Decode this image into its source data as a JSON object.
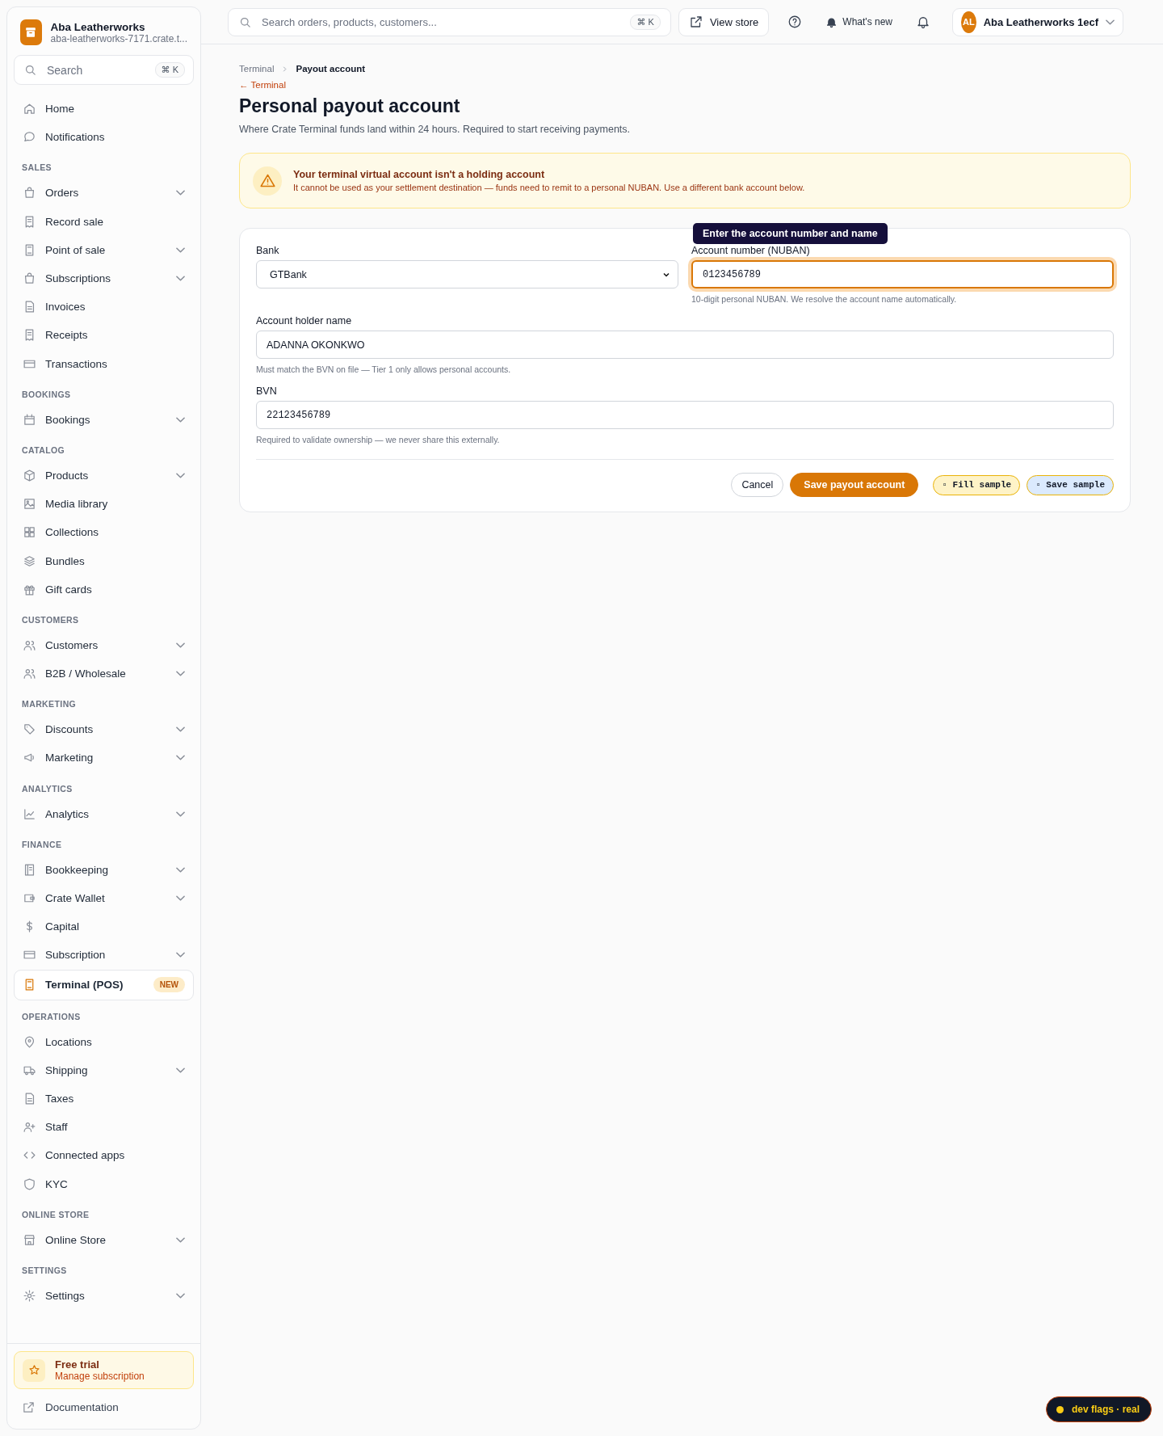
{
  "sidebar": {
    "store_name": "Aba Leatherworks",
    "store_url": "aba-leatherworks-7171.crate.t...",
    "search": {
      "placeholder": "Search",
      "shortcut": "⌘ K"
    },
    "groups": [
      {
        "items": [
          {
            "label": "Home",
            "expandable": false,
            "selected": false
          },
          {
            "label": "Notifications",
            "expandable": false,
            "selected": false
          }
        ]
      },
      {
        "title": "SALES",
        "items": [
          {
            "label": "Orders",
            "expandable": true,
            "selected": false
          },
          {
            "label": "Record sale",
            "expandable": false,
            "selected": false
          },
          {
            "label": "Point of sale",
            "expandable": true,
            "selected": false
          },
          {
            "label": "Subscriptions",
            "expandable": true,
            "selected": false
          },
          {
            "label": "Invoices",
            "expandable": false,
            "selected": false
          },
          {
            "label": "Receipts",
            "expandable": false,
            "selected": false
          },
          {
            "label": "Transactions",
            "expandable": false,
            "selected": false
          }
        ]
      },
      {
        "title": "BOOKINGS",
        "items": [
          {
            "label": "Bookings",
            "expandable": true,
            "selected": false
          }
        ]
      },
      {
        "title": "CATALOG",
        "items": [
          {
            "label": "Products",
            "expandable": true,
            "selected": false
          },
          {
            "label": "Media library",
            "expandable": false,
            "selected": false
          },
          {
            "label": "Collections",
            "expandable": false,
            "selected": false
          },
          {
            "label": "Bundles",
            "expandable": false,
            "selected": false
          },
          {
            "label": "Gift cards",
            "expandable": false,
            "selected": false
          }
        ]
      },
      {
        "title": "CUSTOMERS",
        "items": [
          {
            "label": "Customers",
            "expandable": true,
            "selected": false
          },
          {
            "label": "B2B / Wholesale",
            "expandable": true,
            "selected": false
          }
        ]
      },
      {
        "title": "MARKETING",
        "items": [
          {
            "label": "Discounts",
            "expandable": true,
            "selected": false
          },
          {
            "label": "Marketing",
            "expandable": true,
            "selected": false
          }
        ]
      },
      {
        "title": "ANALYTICS",
        "items": [
          {
            "label": "Analytics",
            "expandable": true,
            "selected": false
          }
        ]
      },
      {
        "title": "FINANCE",
        "items": [
          {
            "label": "Bookkeeping",
            "expandable": true,
            "selected": false
          },
          {
            "label": "Crate Wallet",
            "expandable": true,
            "selected": false
          },
          {
            "label": "Capital",
            "expandable": false,
            "selected": false
          },
          {
            "label": "Subscription",
            "expandable": true,
            "selected": false
          },
          {
            "label": "Terminal (POS)",
            "expandable": false,
            "selected": true,
            "badge": "NEW"
          }
        ]
      },
      {
        "title": "OPERATIONS",
        "items": [
          {
            "label": "Locations",
            "expandable": false,
            "selected": false
          },
          {
            "label": "Shipping",
            "expandable": true,
            "selected": false
          },
          {
            "label": "Taxes",
            "expandable": false,
            "selected": false
          },
          {
            "label": "Staff",
            "expandable": false,
            "selected": false
          },
          {
            "label": "Connected apps",
            "expandable": false,
            "selected": false
          },
          {
            "label": "KYC",
            "expandable": false,
            "selected": false
          }
        ]
      },
      {
        "title": "ONLINE STORE",
        "items": [
          {
            "label": "Online Store",
            "expandable": true,
            "selected": false
          }
        ]
      },
      {
        "title": "SETTINGS",
        "items": [
          {
            "label": "Settings",
            "expandable": true,
            "selected": false
          }
        ]
      }
    ],
    "trial": {
      "title": "Free trial",
      "link": "Manage subscription"
    },
    "documentation": "Documentation"
  },
  "topbar": {
    "search": {
      "placeholder": "Search orders, products, customers...",
      "shortcut": "⌘ K"
    },
    "view_store": "View store",
    "whats_new": "What's new",
    "account": {
      "initials": "AL",
      "name": "Aba Leatherworks 1ecf"
    }
  },
  "page": {
    "breadcrumb": [
      {
        "label": "Terminal",
        "current": false
      },
      {
        "label": "Payout account",
        "current": true
      }
    ],
    "back_link": "← Terminal",
    "title": "Personal payout account",
    "subtitle": "Where Crate Terminal funds land within 24 hours. Required to start receiving payments.",
    "alert": {
      "title": "Your terminal virtual account isn't a holding account",
      "message": "It cannot be used as your settlement destination — funds need to remit to a personal NUBAN. Use a different bank account below."
    },
    "form": {
      "fields": [
        {
          "kind": "select",
          "label": "Bank",
          "value": "GTBank",
          "focused": false
        },
        {
          "kind": "text",
          "label": "Account number (NUBAN)",
          "value": "0123456789",
          "help": "10-digit personal NUBAN. We resolve the account name automatically.",
          "focused": true,
          "tooltip": "Enter the account number and name"
        },
        {
          "kind": "text",
          "label": "Account holder name",
          "value": "ADANNA OKONKWO",
          "help": "Must match the BVN on file — Tier 1 only allows personal accounts.",
          "focused": false
        },
        {
          "kind": "text",
          "label": "BVN",
          "value": "22123456789",
          "help": "Required to validate ownership — we never share this externally.",
          "focused": false
        }
      ],
      "buttons": [
        {
          "label": "Cancel",
          "kind": "secondary"
        },
        {
          "label": "Save payout account",
          "kind": "primary"
        }
      ],
      "dev_buttons": [
        {
          "label": "▫ Fill sample",
          "color": "#fef3c7"
        },
        {
          "label": "▫ Save sample",
          "color": "#dbeafe"
        }
      ]
    }
  },
  "dev_flags": {
    "label": "dev flags · real",
    "color": "#facc15"
  }
}
